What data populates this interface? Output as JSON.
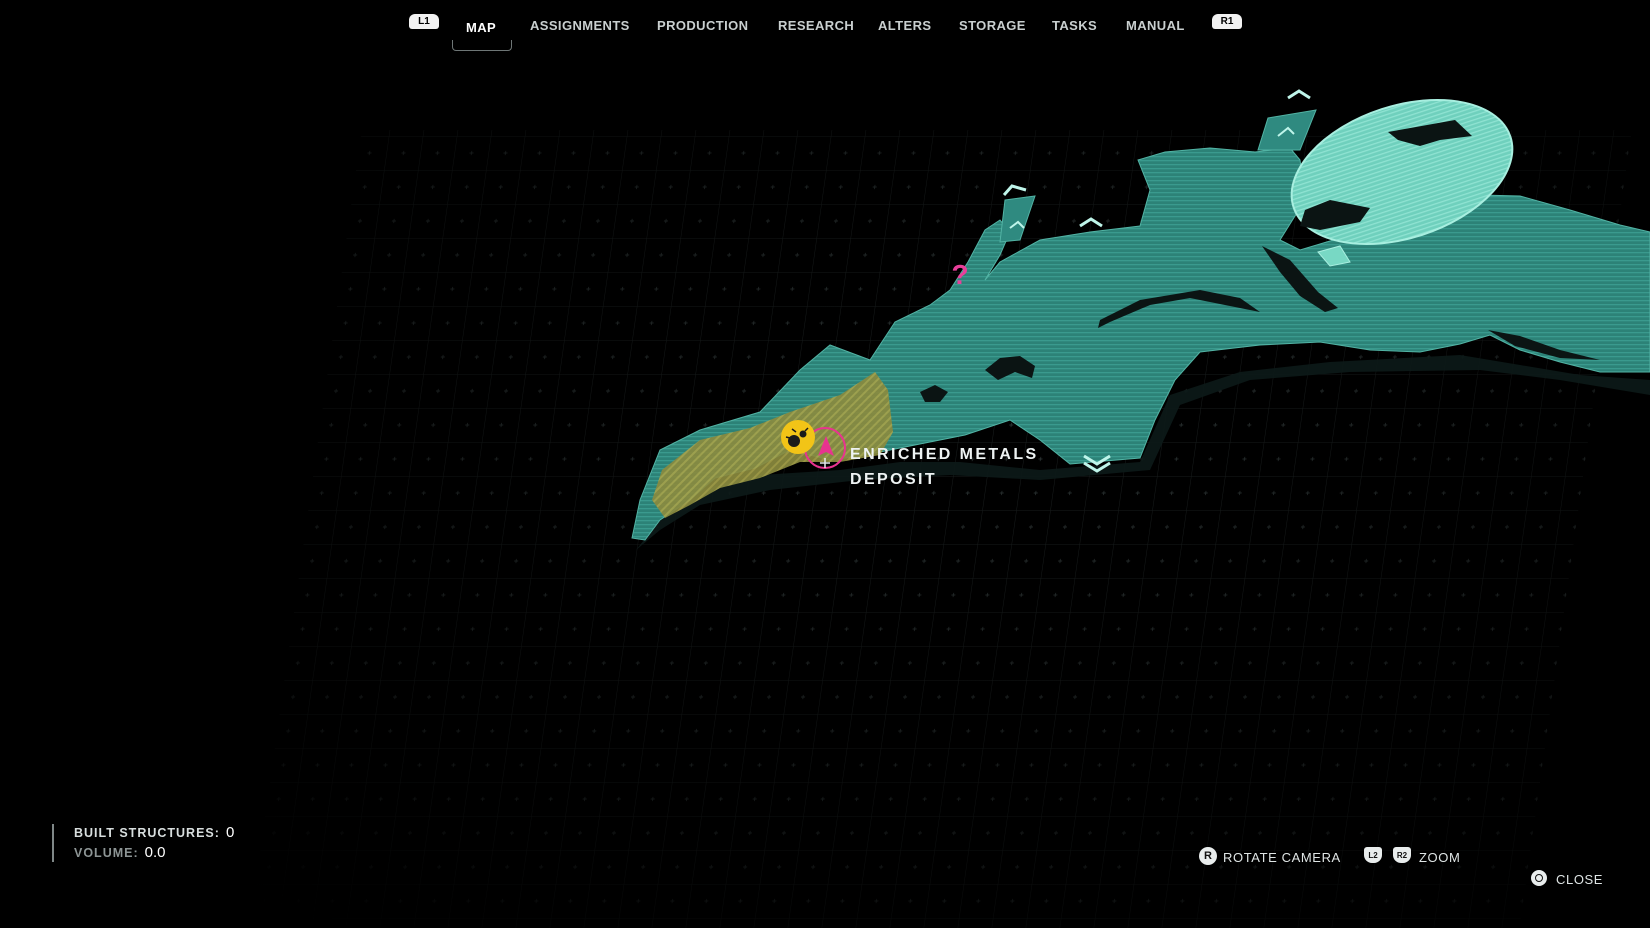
{
  "nav": {
    "left_bumper": "L1",
    "right_bumper": "R1",
    "tabs": [
      {
        "label": "MAP",
        "active": true
      },
      {
        "label": "ASSIGNMENTS",
        "active": false
      },
      {
        "label": "PRODUCTION",
        "active": false
      },
      {
        "label": "RESEARCH",
        "active": false
      },
      {
        "label": "ALTERS",
        "active": false
      },
      {
        "label": "STORAGE",
        "active": false
      },
      {
        "label": "TASKS",
        "active": false
      },
      {
        "label": "MANUAL",
        "active": false
      }
    ]
  },
  "map": {
    "deposit_line1": "ENRICHED METALS",
    "deposit_line2": "DEPOSIT",
    "unknown_marker": "?",
    "colors": {
      "terrain": "#2f8a80",
      "terrain_light": "#78d8c4",
      "resource_area": "#8c8a3a",
      "player_marker": "#e8338f",
      "resource_icon": "#f2c417",
      "unknown_marker": "#e83f9a"
    },
    "icons": [
      "resource-deposit-icon",
      "player-location-icon",
      "unknown-location-icon",
      "elevation-up-icon",
      "elevation-down-icon"
    ]
  },
  "stats": {
    "built_label": "BUILT STRUCTURES:",
    "built_value": "0",
    "volume_label": "VOLUME:",
    "volume_value": "0.0"
  },
  "controls": {
    "rotate_key": "R",
    "rotate_label": "ROTATE CAMERA",
    "zoom_key_1": "L2",
    "zoom_key_2": "R2",
    "zoom_label": "ZOOM",
    "close_label": "CLOSE"
  }
}
